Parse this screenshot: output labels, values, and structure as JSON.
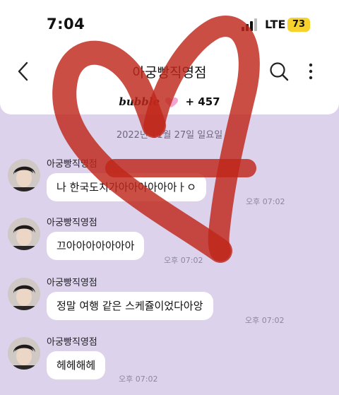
{
  "status": {
    "time": "7:04",
    "network": "LTE",
    "battery": "73"
  },
  "header": {
    "title": "아궁빵직영점",
    "bubble_word": "bubble",
    "bubble_count": "+ 457"
  },
  "chat": {
    "date": "2022년 11월 27일 일요일",
    "messages": [
      {
        "sender": "아궁빵직영점",
        "text": "나 한국도치가아아아아아아ㅏㅇ",
        "time": "오후 07:02"
      },
      {
        "sender": "아궁빵직영점",
        "text": "끄아아아아아아아",
        "time": "오후 07:02"
      },
      {
        "sender": "아궁빵직영점",
        "text": "정말 여행 같은 스케쥴이었다아앙",
        "time": "오후 07:02"
      },
      {
        "sender": "아궁빵직영점",
        "text": "헤헤해헤",
        "time": "오후 07:02"
      }
    ]
  },
  "colors": {
    "background": "#dcd2ec",
    "heart_drawing": "#c0271b",
    "battery": "#f7d22c"
  }
}
